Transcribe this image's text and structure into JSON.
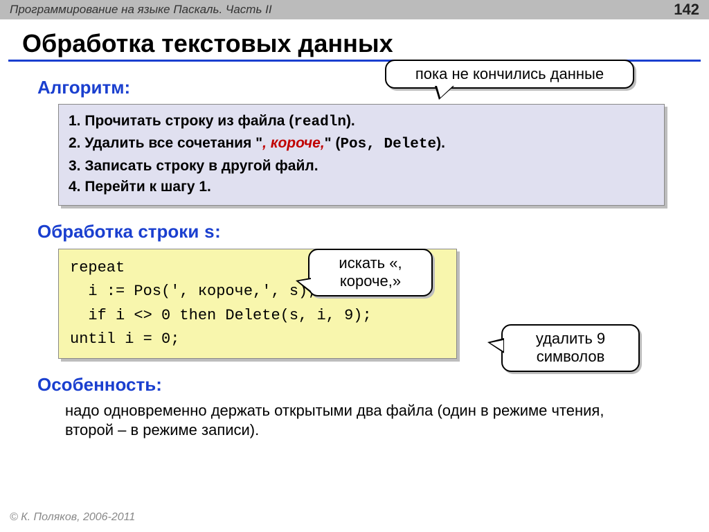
{
  "header": {
    "breadcrumb": "Программирование на языке Паскаль. Часть II",
    "page_number": "142"
  },
  "title": "Обработка текстовых данных",
  "section_algorithm": {
    "heading": "Алгоритм:",
    "step1_pre": "1. Прочитать строку из файла (",
    "step1_code": "readln",
    "step1_post": ").",
    "step2_pre": "2. Удалить все сочетания \"",
    "step2_em": ", короче,",
    "step2_mid": "\" (",
    "step2_code": "Pos, Delete",
    "step2_post": ").",
    "step3": "3. Записать строку в другой файл.",
    "step4": "4. Перейти к шагу 1."
  },
  "section_processing": {
    "heading_pre": "Обработка строки ",
    "heading_var": "s",
    "heading_post": ":",
    "code": "repeat\n  i := Pos(', короче,', s);\n  if i <> 0 then Delete(s, i, 9);\nuntil i = 0;"
  },
  "section_feature": {
    "heading": "Особенность:",
    "body": "надо одновременно держать открытыми два файла (один в режиме чтения, второй – в режиме записи)."
  },
  "bubbles": {
    "until_data": "пока не кончились данные",
    "search": "искать «, короче,»",
    "delete9": "удалить 9 символов"
  },
  "footer": "© К. Поляков, 2006-2011"
}
